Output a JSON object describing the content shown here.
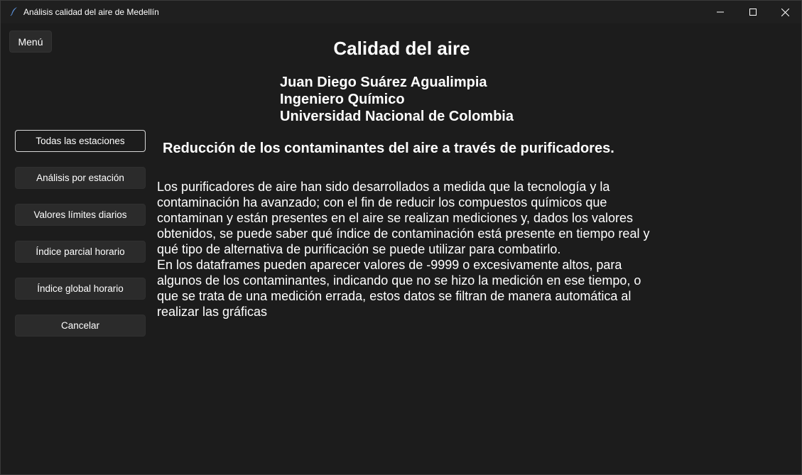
{
  "window": {
    "title": "Análisis calidad del aire de Medellín",
    "icon": "feather-icon"
  },
  "menu": {
    "label": "Menú"
  },
  "sidebar": {
    "items": [
      {
        "label": "Todas las estaciones",
        "active": true
      },
      {
        "label": "Análisis por estación",
        "active": false
      },
      {
        "label": "Valores límites diarios",
        "active": false
      },
      {
        "label": "Índice parcial horario",
        "active": false
      },
      {
        "label": "Índice global horario",
        "active": false
      },
      {
        "label": "Cancelar",
        "active": false
      }
    ]
  },
  "main": {
    "title": "Calidad del aire",
    "author": {
      "name": "Juan Diego Suárez Agualimpia",
      "profession": "Ingeniero Químico",
      "university": "Universidad Nacional de Colombia"
    },
    "subtitle": "Reducción de los contaminantes del aire a través de purificadores.",
    "paragraphs": [
      "Los purificadores de aire han sido desarrollados a medida que la tecnología y la contaminación ha avanzado; con el fin de reducir los compuestos químicos que contaminan y están presentes en el aire se realizan mediciones y, dados los valores obtenidos, se puede saber qué índice de contaminación está presente en tiempo real y qué tipo de alternativa de purificación se puede utilizar para combatirlo.",
      "En los dataframes pueden aparecer valores de -9999 o excesivamente altos, para algunos de los contaminantes, indicando que no se hizo la medición en ese tiempo, o que se trata de una medición errada, estos datos se filtran de manera automática al realizar las gráficas"
    ]
  },
  "colors": {
    "background": "#1c1c1c",
    "button": "#2b2b2b",
    "active_border": "#d8d8d8",
    "text": "#ffffff"
  }
}
